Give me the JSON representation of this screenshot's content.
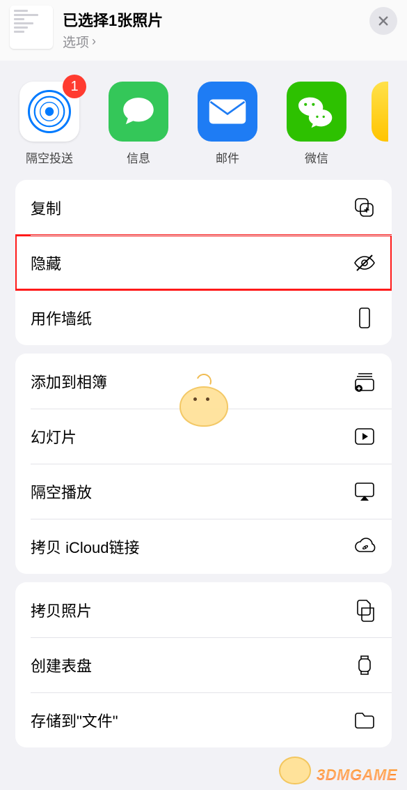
{
  "header": {
    "title": "已选择1张照片",
    "options_label": "选项",
    "badge_count": "1"
  },
  "apps": {
    "airdrop": "隔空投送",
    "messages": "信息",
    "mail": "邮件",
    "wechat": "微信"
  },
  "actions": {
    "copy": "复制",
    "hide": "隐藏",
    "wallpaper": "用作墙纸",
    "add_album": "添加到相簿",
    "slideshow": "幻灯片",
    "airplay": "隔空播放",
    "icloud_link": "拷贝 iCloud链接",
    "copy_photo": "拷贝照片",
    "watchface": "创建表盘",
    "save_files": "存储到\"文件\""
  },
  "watermark": "3DMGAME"
}
